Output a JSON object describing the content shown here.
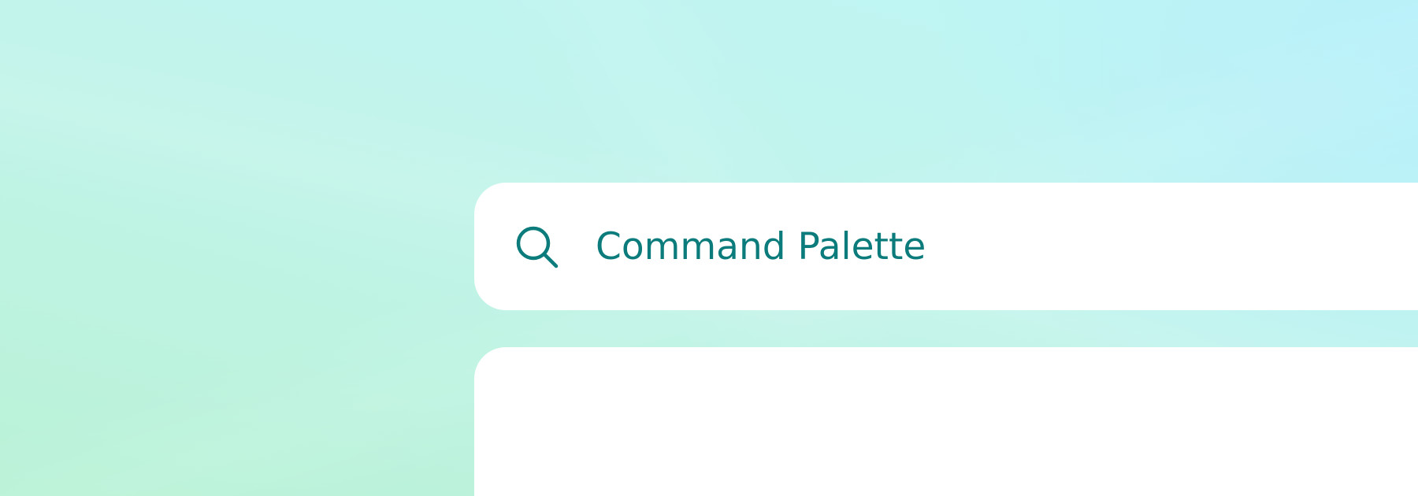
{
  "command_palette": {
    "search_icon": "search-icon",
    "placeholder": "Command Palette",
    "accent_color": "#0b7b7b"
  },
  "background": {
    "gradient_colors": [
      "#b9f2d6",
      "#c2f4ec",
      "#b8f0fa"
    ]
  }
}
